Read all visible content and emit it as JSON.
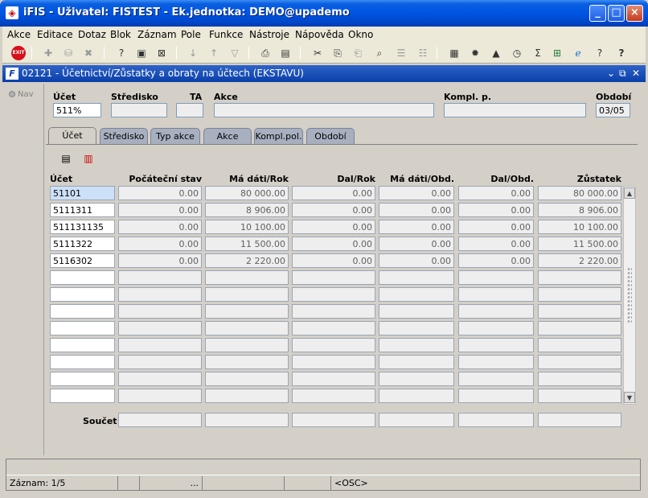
{
  "window": {
    "title": "iFIS - Uživatel: FISTEST - Ek.jednotka: DEMO@upademo",
    "app_icon": "app-logo",
    "minimize": "_",
    "maximize": "□",
    "close": "×"
  },
  "menu": [
    "Akce",
    "Editace",
    "Dotaz",
    "Blok",
    "Záznam",
    "Pole",
    "Funkce",
    "Nástroje",
    "Nápověda",
    "Okno"
  ],
  "toolbar": {
    "exit_label": "EXIT",
    "icons": [
      "exit-icon",
      "new-record-icon",
      "save-icon",
      "clear-icon",
      "enter-query-icon",
      "execute-query-icon",
      "cancel-query-icon",
      "sort-asc-icon",
      "sort-desc-icon",
      "filter-icon",
      "print-icon",
      "print-preview-icon",
      "cut-icon",
      "copy-icon",
      "paste-icon",
      "find-icon",
      "insert-row-icon",
      "delete-row-icon",
      "calculator-icon",
      "settings-icon",
      "chart-icon",
      "clock-icon",
      "sum-icon",
      "excel-icon",
      "ie-icon",
      "help-topic-icon",
      "help-icon"
    ]
  },
  "form": {
    "title": "02121 - Účetnictví/Zůstatky a obraty na účtech (EKSTAVU)",
    "nav_label": "Nav",
    "labels": {
      "ucet": "Účet",
      "stredisko": "Středisko",
      "ta": "TA",
      "akce": "Akce",
      "kompl": "Kompl. p.",
      "obdobi": "Období"
    },
    "values": {
      "ucet": "511%",
      "stredisko": "",
      "ta": "",
      "akce": "",
      "kompl": "",
      "obdobi": "03/05"
    }
  },
  "tabs": [
    "Účet",
    "Středisko",
    "Typ akce",
    "Akce",
    "Kompl.pol.",
    "Období"
  ],
  "grid": {
    "columns": [
      "Účet",
      "Počáteční stav",
      "Má dáti/Rok",
      "Dal/Rok",
      "Má dáti/Obd.",
      "Dal/Obd.",
      "Zůstatek"
    ],
    "rows": [
      [
        "51101",
        "0.00",
        "80 000.00",
        "0.00",
        "0.00",
        "0.00",
        "80 000.00"
      ],
      [
        "5111311",
        "0.00",
        "8 906.00",
        "0.00",
        "0.00",
        "0.00",
        "8 906.00"
      ],
      [
        "511131135",
        "0.00",
        "10 100.00",
        "0.00",
        "0.00",
        "0.00",
        "10 100.00"
      ],
      [
        "5111322",
        "0.00",
        "11 500.00",
        "0.00",
        "0.00",
        "0.00",
        "11 500.00"
      ],
      [
        "5116302",
        "0.00",
        "2 220.00",
        "0.00",
        "0.00",
        "0.00",
        "2 220.00"
      ]
    ],
    "total_rows": 13,
    "sum_label": "Součet"
  },
  "status": {
    "record": "Záznam: 1/5",
    "dots": "...",
    "mode": "<OSC>"
  }
}
